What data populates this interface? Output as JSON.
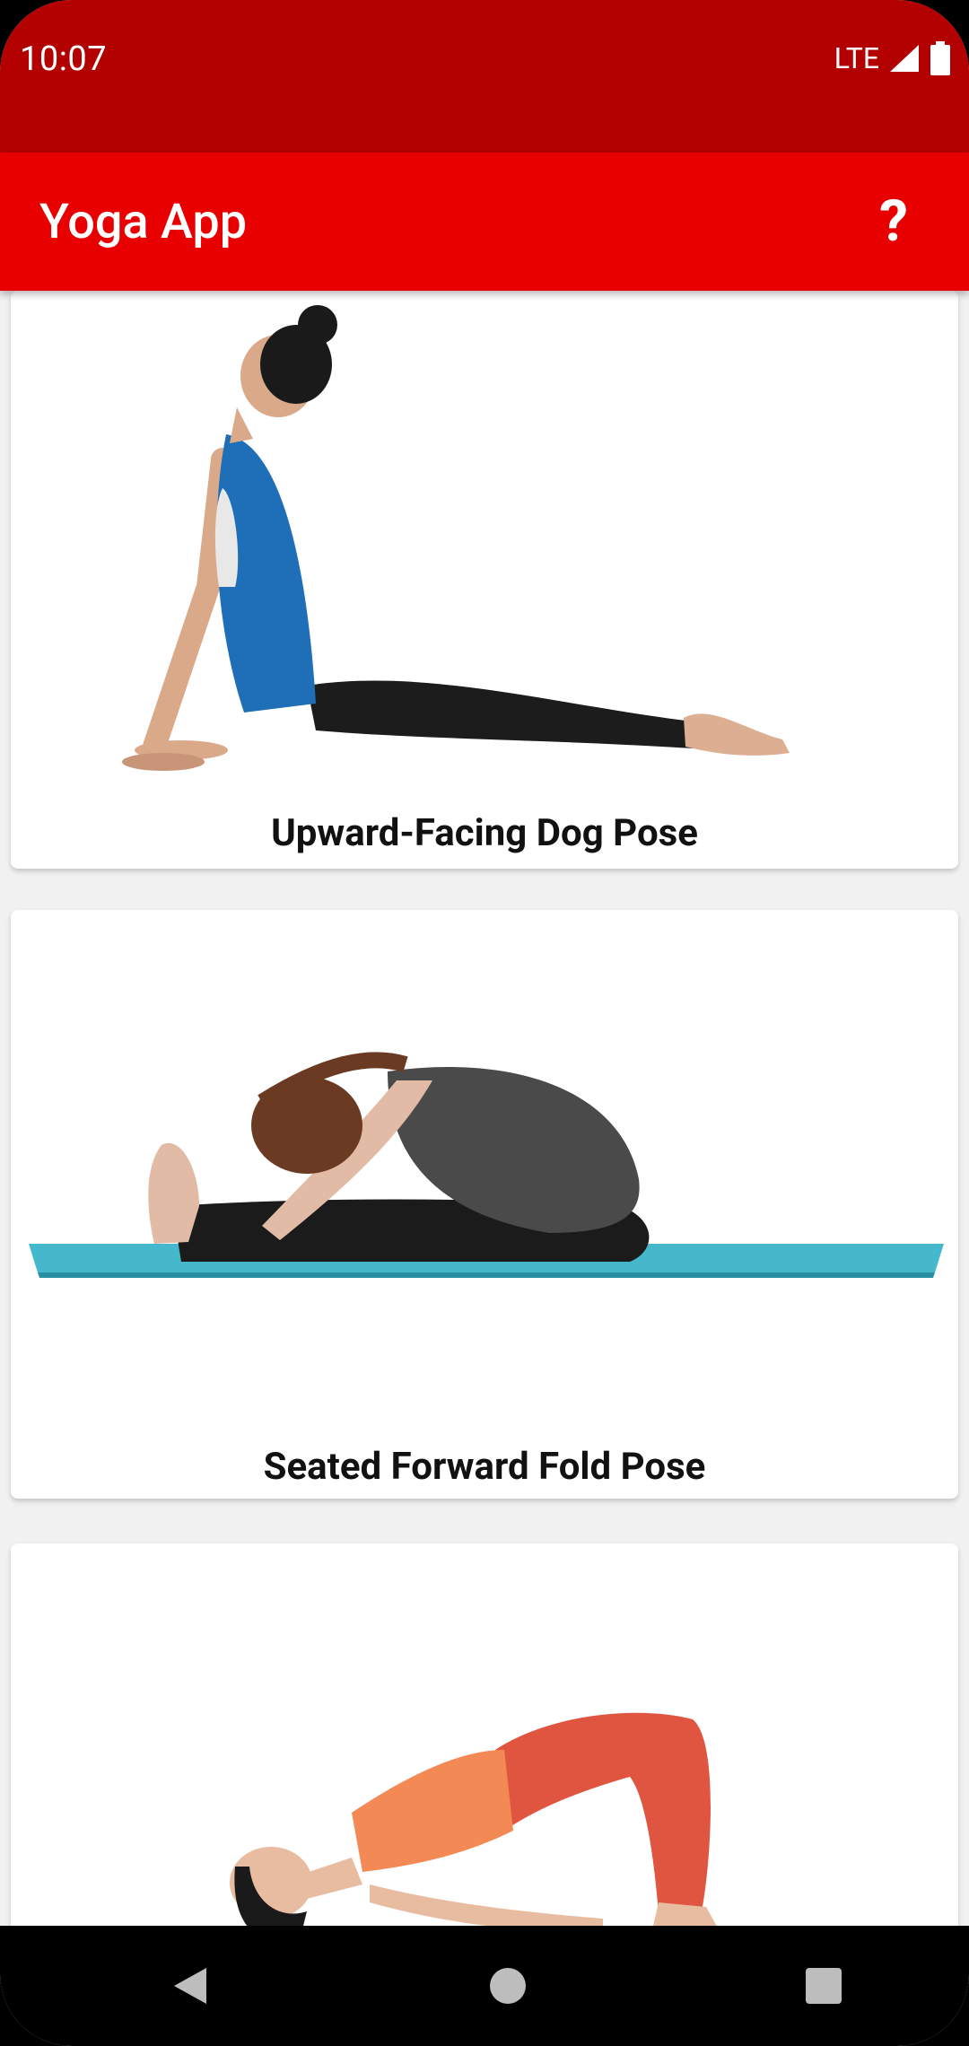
{
  "status_bar": {
    "time": "10:07",
    "network": "LTE",
    "icons": [
      "signal-icon",
      "battery-icon"
    ]
  },
  "app_bar": {
    "title": "Yoga App",
    "help_label": "?"
  },
  "poses": [
    {
      "name": "Upward-Facing Dog Pose",
      "image": "upward-facing-dog-illustration"
    },
    {
      "name": "Seated Forward Fold Pose",
      "image": "seated-forward-fold-illustration"
    },
    {
      "name": "",
      "image": "bridge-pose-illustration"
    }
  ],
  "nav_bar": {
    "buttons": [
      "back-icon",
      "home-icon",
      "recents-icon"
    ]
  },
  "colors": {
    "status_bar": "#b30000",
    "app_bar": "#e80000",
    "background": "#f1f1f1",
    "card": "#ffffff"
  }
}
